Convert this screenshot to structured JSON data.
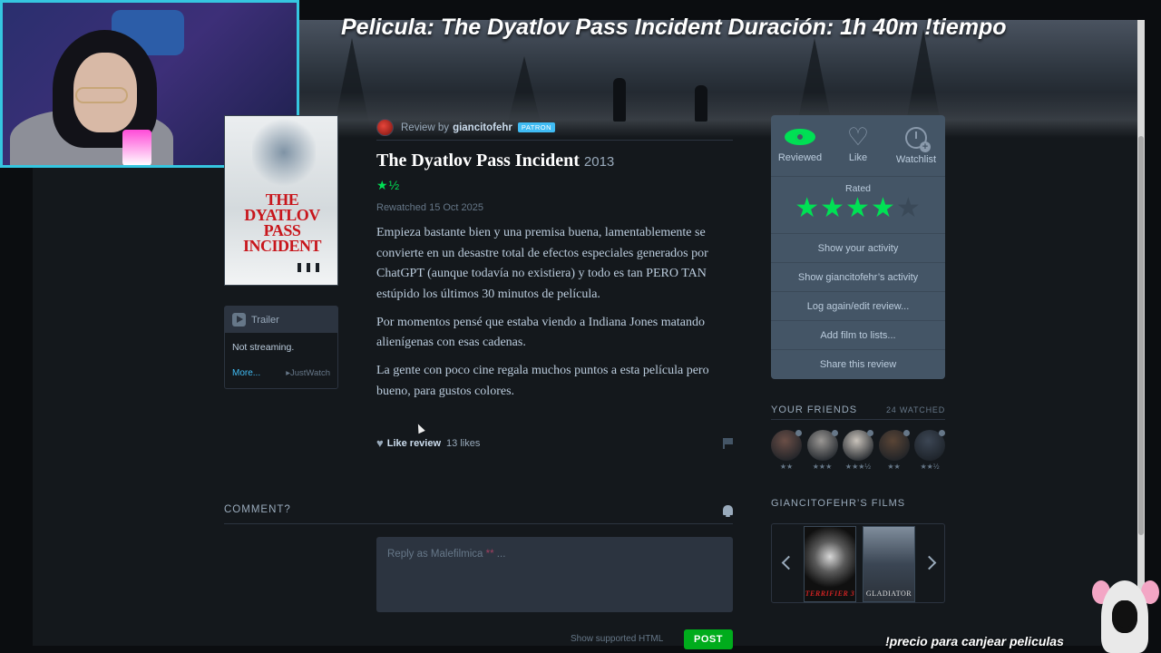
{
  "stream_overlay": {
    "title": "Pelicula: The Dyatlov Pass Incident  Duración: 1h 40m  !tiempo",
    "bottom_text": "!precio para canjear peliculas"
  },
  "poster": {
    "title_text": "THE DYATLOV PASS INCIDENT"
  },
  "trailer": {
    "label": "Trailer",
    "streaming_status": "Not streaming.",
    "more_link": "More...",
    "provider": "JustWatch"
  },
  "review": {
    "by_prefix": "Review by",
    "username": "giancitofehr",
    "badge": "PATRON",
    "film_title": "The Dyatlov Pass Incident",
    "film_year": "2013",
    "rating_display": "★½",
    "rewatched": "Rewatched 15 Oct 2025",
    "paragraphs": [
      "Empieza bastante bien y una premisa buena, lamentablemente se convierte en un desastre total de efectos especiales generados por ChatGPT (aunque todavía no existiera) y todo es tan PERO TAN estúpido los últimos 30 minutos de película.",
      "Por momentos pensé que estaba viendo a Indiana Jones matando alienígenas con esas cadenas.",
      "La gente con poco cine regala muchos puntos a esta película pero bueno, para gustos colores."
    ],
    "like_label": "Like review",
    "likes_count": "13 likes"
  },
  "comment": {
    "heading": "COMMENT?",
    "reply_placeholder_prefix": "Reply as Malefilmica ",
    "reply_placeholder_stars": "**",
    "reply_placeholder_suffix": " ...",
    "show_html": "Show supported HTML",
    "post_label": "POST"
  },
  "actions": {
    "reviewed": "Reviewed",
    "like": "Like",
    "watchlist": "Watchlist",
    "rated_label": "Rated",
    "user_rating_stars": 4,
    "user_rating_max": 5,
    "links": [
      "Show your activity",
      "Show giancitofehr’s activity",
      "Log again/edit review...",
      "Add film to lists...",
      "Share this review"
    ]
  },
  "friends": {
    "heading": "YOUR FRIENDS",
    "watched_count": "24 WATCHED",
    "list": [
      {
        "rating": "★★",
        "color": "#6b4f47"
      },
      {
        "rating": "★★★",
        "color": "#9a9794"
      },
      {
        "rating": "★★★½",
        "color": "#c9c3bb"
      },
      {
        "rating": "★★",
        "color": "#5a4536"
      },
      {
        "rating": "★★½",
        "color": "#3c4654"
      }
    ]
  },
  "user_films": {
    "heading": "GIANCITOFEHR’S FILMS",
    "films": [
      {
        "title": "TERRIFIER 3"
      },
      {
        "title": "GLADIATOR"
      }
    ]
  },
  "colors": {
    "accent_green": "#00e054",
    "link_blue": "#40bcf4",
    "panel": "#445566",
    "background": "#14181c"
  }
}
